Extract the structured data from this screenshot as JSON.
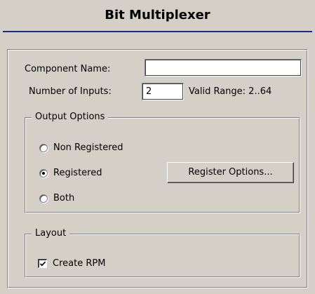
{
  "title": "Bit Multiplexer",
  "component_name": {
    "label": "Component Name:",
    "value": ""
  },
  "number_of_inputs": {
    "label": "Number of Inputs:",
    "value": "2",
    "valid_range": "Valid Range: 2..64"
  },
  "output_options": {
    "legend": "Output Options",
    "options": [
      {
        "label": "Non Registered",
        "checked": false
      },
      {
        "label": "Registered",
        "checked": true
      },
      {
        "label": "Both",
        "checked": false
      }
    ],
    "register_options_button": "Register Options..."
  },
  "layout": {
    "legend": "Layout",
    "create_rpm_label": "Create RPM",
    "create_rpm_checked": true
  },
  "colors": {
    "dialog_bg": "#d4d0c8",
    "title_rule": "#1a2b8a"
  }
}
